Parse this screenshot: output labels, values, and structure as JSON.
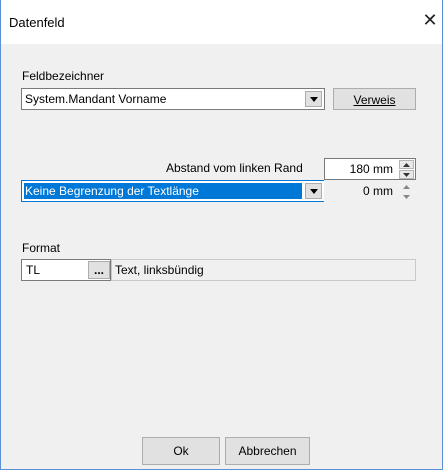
{
  "window": {
    "title": "Datenfeld"
  },
  "fieldname": {
    "label": "Feldbezeichner",
    "value": "System.Mandant Vorname",
    "reference_button": "Verweis"
  },
  "margin": {
    "label": "Abstand vom linken Rand",
    "value": "180 mm"
  },
  "text_length": {
    "value": "Keine Begrenzung der Textlänge",
    "width_value": "0 mm"
  },
  "format": {
    "label": "Format",
    "code": "TL",
    "browse_label": "...",
    "description": "Text, linksbündig"
  },
  "buttons": {
    "ok": "Ok",
    "cancel": "Abbrechen"
  },
  "colors": {
    "selection": "#0078d7",
    "accent_border": "#0078d7",
    "face": "#f0f0f0"
  }
}
